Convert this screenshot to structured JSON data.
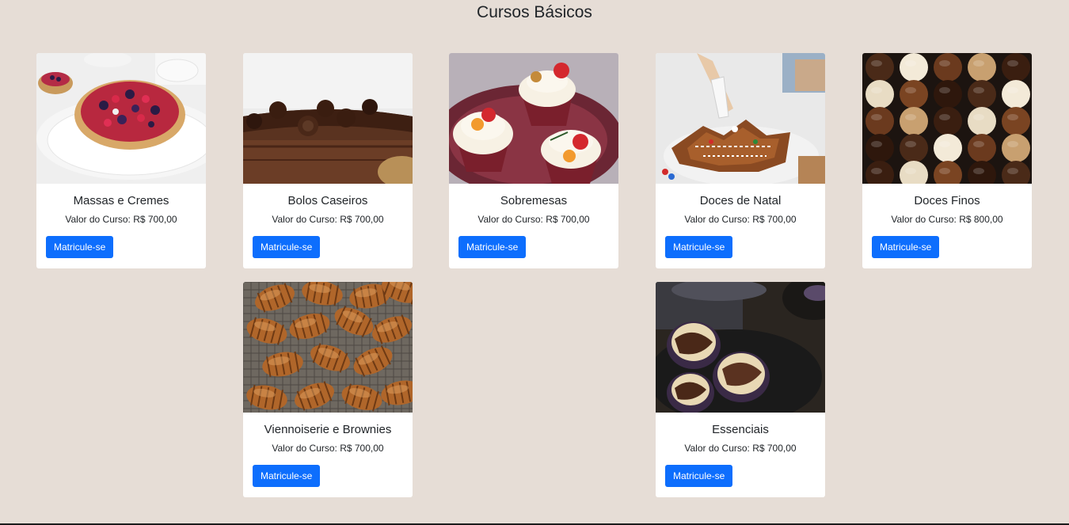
{
  "section": {
    "title": "Cursos Básicos"
  },
  "courses": [
    {
      "title": "Massas e Cremes",
      "price": "Valor do Curso: R$ 700,00",
      "button": "Matricule-se",
      "image": "fruit-tart-photo"
    },
    {
      "title": "Bolos Caseiros",
      "price": "Valor do Curso: R$ 700,00",
      "button": "Matricule-se",
      "image": "chocolate-cake-photo"
    },
    {
      "title": "Sobremesas",
      "price": "Valor do Curso: R$ 700,00",
      "button": "Matricule-se",
      "image": "cupcakes-photo"
    },
    {
      "title": "Doces de Natal",
      "price": "Valor do Curso: R$ 700,00",
      "button": "Matricule-se",
      "image": "gingerbread-cookies-photo"
    },
    {
      "title": "Doces Finos",
      "price": "Valor do Curso: R$ 800,00",
      "button": "Matricule-se",
      "image": "bonbons-photo"
    },
    {
      "title": "Viennoiserie e Brownies",
      "price": "Valor do Curso: R$ 700,00",
      "button": "Matricule-se",
      "image": "croissants-photo"
    },
    {
      "title": "Essenciais",
      "price": "Valor do Curso: R$ 700,00",
      "button": "Matricule-se",
      "image": "muffins-photo"
    }
  ],
  "colors": {
    "background": "#e6ddd6",
    "card": "#ffffff",
    "button": "#0d6efd",
    "button_text": "#ffffff",
    "text": "#212529"
  }
}
